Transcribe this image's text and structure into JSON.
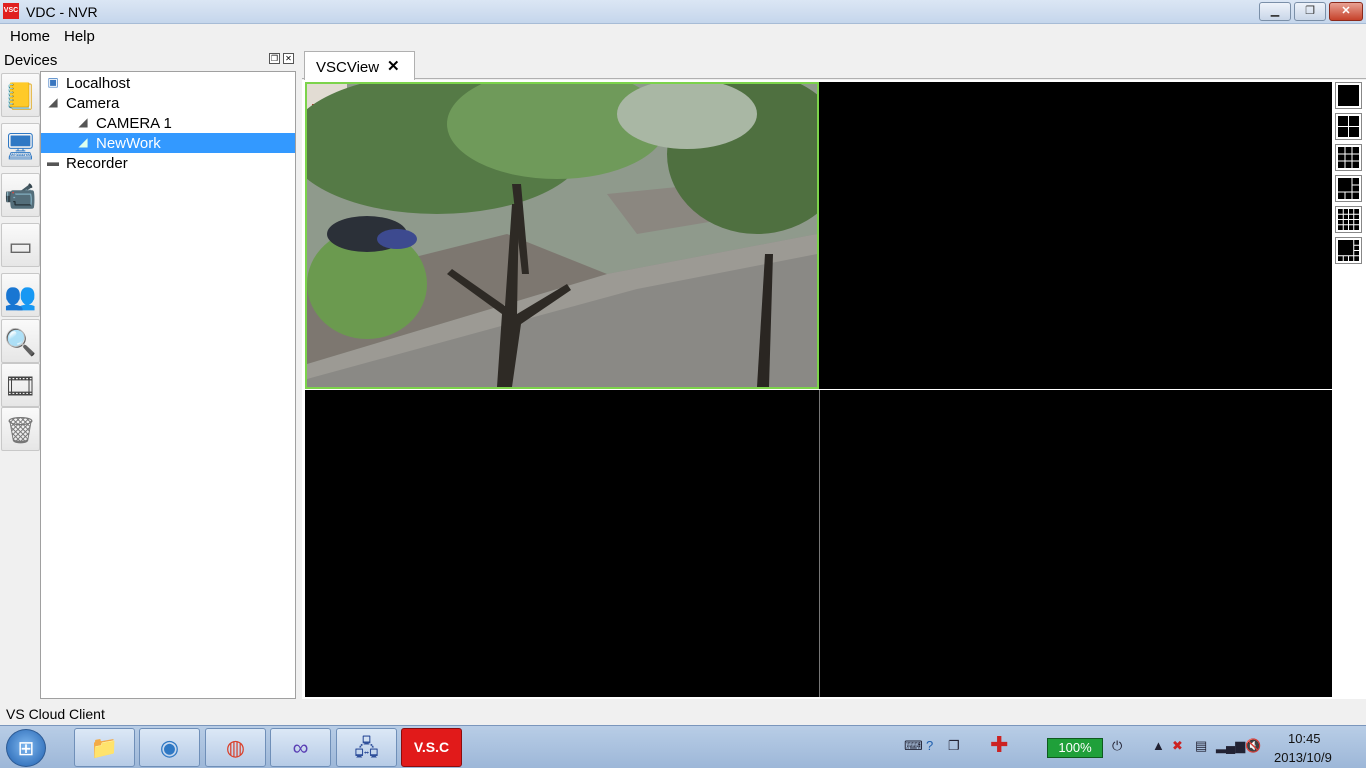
{
  "window": {
    "title": "VDC - NVR",
    "app_icon_text": "VSC",
    "min_icon": "minimize-icon",
    "max_icon": "restore-icon",
    "close_icon": "close-icon"
  },
  "menubar": {
    "items": [
      {
        "label": "Home"
      },
      {
        "label": "Help"
      }
    ]
  },
  "devices_panel": {
    "title": "Devices",
    "float_icon": "float-icon",
    "close_icon": "close-icon",
    "toolbar": [
      {
        "icon": "notepad-icon"
      },
      {
        "icon": "monitor-icon"
      },
      {
        "icon": "camera-icon"
      },
      {
        "icon": "hard-drive-icon"
      },
      {
        "icon": "users-icon"
      },
      {
        "icon": "magnifier-icon"
      },
      {
        "icon": "film-reel-icon"
      },
      {
        "icon": "trash-icon"
      }
    ],
    "tree": [
      {
        "label": "Localhost",
        "icon": "computer-icon",
        "level": 0,
        "selected": false
      },
      {
        "label": "Camera",
        "icon": "camera-group-icon",
        "level": 0,
        "selected": false
      },
      {
        "label": "CAMERA 1",
        "icon": "camera-icon",
        "level": 1,
        "selected": false
      },
      {
        "label": "NewWork",
        "icon": "camera-icon",
        "level": 1,
        "selected": true
      },
      {
        "label": "Recorder",
        "icon": "recorder-icon",
        "level": 0,
        "selected": false
      }
    ]
  },
  "view": {
    "tab": {
      "label": "VSCView",
      "close": "✕"
    },
    "cells": [
      {
        "content": "live street camera feed with trees and parked scooters",
        "active": true
      },
      {
        "content": "empty",
        "active": false
      },
      {
        "content": "empty",
        "active": false
      },
      {
        "content": "empty",
        "active": false
      }
    ],
    "layouts": [
      {
        "icon": "layout-1x1-icon"
      },
      {
        "icon": "layout-2x2-icon"
      },
      {
        "icon": "layout-3x3-icon"
      },
      {
        "icon": "layout-1plus5-icon"
      },
      {
        "icon": "layout-4x4-icon"
      },
      {
        "icon": "layout-1plus7-icon"
      }
    ]
  },
  "status": {
    "text": "VS Cloud Client"
  },
  "taskbar": {
    "start_icon": "windows-start-icon",
    "apps": [
      {
        "icon": "folder-icon"
      },
      {
        "icon": "ie-icon"
      },
      {
        "icon": "chrome-icon"
      },
      {
        "icon": "infinity-icon"
      },
      {
        "icon": "network-icon"
      },
      {
        "icon": "vsc-app-icon",
        "label": "V.S.C"
      }
    ],
    "tray": {
      "battery": "100%",
      "time": "10:45",
      "date": "2013/10/9"
    }
  },
  "colors": {
    "selection": "#3399ff",
    "active_cell_border": "#7cd34b",
    "vsc_red": "#e11a1a"
  }
}
